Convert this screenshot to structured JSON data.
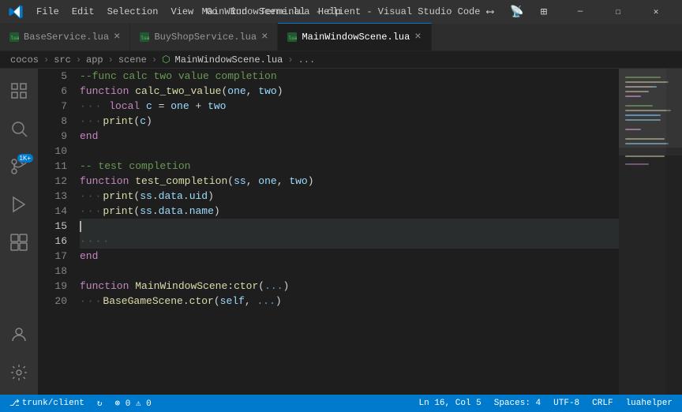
{
  "titleBar": {
    "title": "MainWindowScene.lua - client - Visual Studio Code",
    "menus": [
      "File",
      "Edit",
      "Selection",
      "View",
      "Go",
      "Run",
      "Terminal",
      "Help"
    ],
    "winButtons": [
      "—",
      "☐",
      "✕"
    ]
  },
  "tabs": [
    {
      "id": "tab-base",
      "label": "BaseService.lua",
      "active": false,
      "modified": false
    },
    {
      "id": "tab-buy",
      "label": "BuyShopService.lua",
      "active": false,
      "modified": false
    },
    {
      "id": "tab-main",
      "label": "MainWindowScene.lua",
      "active": true,
      "modified": false
    }
  ],
  "breadcrumb": {
    "parts": [
      "cocos",
      "src",
      "app",
      "scene",
      "MainWindowScene.lua",
      "..."
    ]
  },
  "activityBar": {
    "icons": [
      {
        "id": "explorer",
        "symbol": "⎘",
        "active": false
      },
      {
        "id": "search",
        "symbol": "🔍",
        "active": false
      },
      {
        "id": "source-control",
        "symbol": "⎇",
        "badge": "1K+",
        "active": false
      },
      {
        "id": "run",
        "symbol": "▶",
        "active": false
      },
      {
        "id": "extensions",
        "symbol": "⊞",
        "active": false
      }
    ],
    "bottomIcons": [
      {
        "id": "account",
        "symbol": "👤"
      },
      {
        "id": "settings",
        "symbol": "⚙"
      }
    ]
  },
  "editor": {
    "lines": [
      {
        "num": 5,
        "tokens": [
          {
            "t": "comment",
            "v": "--func calc two value completion"
          }
        ]
      },
      {
        "num": 6,
        "tokens": [
          {
            "t": "kw",
            "v": "function"
          },
          {
            "t": "op",
            "v": " "
          },
          {
            "t": "fn",
            "v": "calc_two_value"
          },
          {
            "t": "punc",
            "v": "("
          },
          {
            "t": "param",
            "v": "one"
          },
          {
            "t": "punc",
            "v": ", "
          },
          {
            "t": "param",
            "v": "two"
          },
          {
            "t": "punc",
            "v": ")"
          }
        ]
      },
      {
        "num": 7,
        "tokens": [
          {
            "t": "indent",
            "v": "···"
          },
          {
            "t": "kw",
            "v": "local"
          },
          {
            "t": "op",
            "v": " "
          },
          {
            "t": "var",
            "v": "c"
          },
          {
            "t": "op",
            "v": " = "
          },
          {
            "t": "var",
            "v": "one"
          },
          {
            "t": "op",
            "v": " + "
          },
          {
            "t": "var",
            "v": "two"
          }
        ]
      },
      {
        "num": 8,
        "tokens": [
          {
            "t": "indent",
            "v": "···"
          },
          {
            "t": "fn",
            "v": "print"
          },
          {
            "t": "punc",
            "v": "("
          },
          {
            "t": "var",
            "v": "c"
          },
          {
            "t": "punc",
            "v": ")"
          }
        ]
      },
      {
        "num": 9,
        "tokens": [
          {
            "t": "kw",
            "v": "end"
          }
        ]
      },
      {
        "num": 10,
        "tokens": []
      },
      {
        "num": 11,
        "tokens": [
          {
            "t": "comment",
            "v": "-- test completion"
          }
        ]
      },
      {
        "num": 12,
        "tokens": [
          {
            "t": "kw",
            "v": "function"
          },
          {
            "t": "op",
            "v": " "
          },
          {
            "t": "fn",
            "v": "test_completion"
          },
          {
            "t": "punc",
            "v": "("
          },
          {
            "t": "param",
            "v": "ss"
          },
          {
            "t": "punc",
            "v": ", "
          },
          {
            "t": "param",
            "v": "one"
          },
          {
            "t": "punc",
            "v": ", "
          },
          {
            "t": "param",
            "v": "two"
          },
          {
            "t": "punc",
            "v": ")"
          }
        ]
      },
      {
        "num": 13,
        "tokens": [
          {
            "t": "indent",
            "v": "···"
          },
          {
            "t": "fn",
            "v": "print"
          },
          {
            "t": "punc",
            "v": "("
          },
          {
            "t": "var",
            "v": "ss"
          },
          {
            "t": "punc",
            "v": "."
          },
          {
            "t": "prop",
            "v": "data"
          },
          {
            "t": "punc",
            "v": "."
          },
          {
            "t": "prop",
            "v": "uid"
          },
          {
            "t": "punc",
            "v": ")"
          }
        ]
      },
      {
        "num": 14,
        "tokens": [
          {
            "t": "indent",
            "v": "···"
          },
          {
            "t": "fn",
            "v": "print"
          },
          {
            "t": "punc",
            "v": "("
          },
          {
            "t": "var",
            "v": "ss"
          },
          {
            "t": "punc",
            "v": "."
          },
          {
            "t": "prop",
            "v": "data"
          },
          {
            "t": "punc",
            "v": "."
          },
          {
            "t": "prop",
            "v": "name"
          },
          {
            "t": "punc",
            "v": ")"
          }
        ]
      },
      {
        "num": 15,
        "tokens": [
          {
            "t": "cursor",
            "v": ""
          }
        ],
        "isCursor": true
      },
      {
        "num": 16,
        "tokens": [
          {
            "t": "indent",
            "v": "····"
          }
        ]
      },
      {
        "num": 17,
        "tokens": [
          {
            "t": "kw",
            "v": "end"
          }
        ]
      },
      {
        "num": 18,
        "tokens": []
      },
      {
        "num": 19,
        "tokens": [
          {
            "t": "kw",
            "v": "function"
          },
          {
            "t": "op",
            "v": " "
          },
          {
            "t": "fn",
            "v": "MainWindowScene"
          },
          {
            "t": "punc",
            "v": ":"
          },
          {
            "t": "fn",
            "v": "ctor"
          },
          {
            "t": "punc",
            "v": "("
          },
          {
            "t": "dots",
            "v": "..."
          },
          {
            "t": "punc",
            "v": ")"
          }
        ]
      },
      {
        "num": 20,
        "tokens": [
          {
            "t": "indent",
            "v": "···"
          },
          {
            "t": "fn",
            "v": "BaseGameScene"
          },
          {
            "t": "punc",
            "v": "."
          },
          {
            "t": "fn",
            "v": "ctor"
          },
          {
            "t": "punc",
            "v": "("
          },
          {
            "t": "var",
            "v": "self"
          },
          {
            "t": "punc",
            "v": ", "
          },
          {
            "t": "dots",
            "v": "..."
          },
          {
            "t": "punc",
            "v": ")"
          }
        ]
      }
    ]
  },
  "statusBar": {
    "left": [
      {
        "id": "branch",
        "icon": "⎇",
        "text": "trunk/client"
      },
      {
        "id": "sync",
        "icon": "↻",
        "text": ""
      },
      {
        "id": "errors",
        "text": "⊗ 0  ⚠ 0"
      }
    ],
    "right": [
      {
        "id": "cursor-pos",
        "text": "Ln 16, Col 5"
      },
      {
        "id": "spaces",
        "text": "Spaces: 4"
      },
      {
        "id": "encoding",
        "text": "UTF-8"
      },
      {
        "id": "line-ending",
        "text": "CRLF"
      },
      {
        "id": "language",
        "text": "luahelper"
      }
    ]
  }
}
